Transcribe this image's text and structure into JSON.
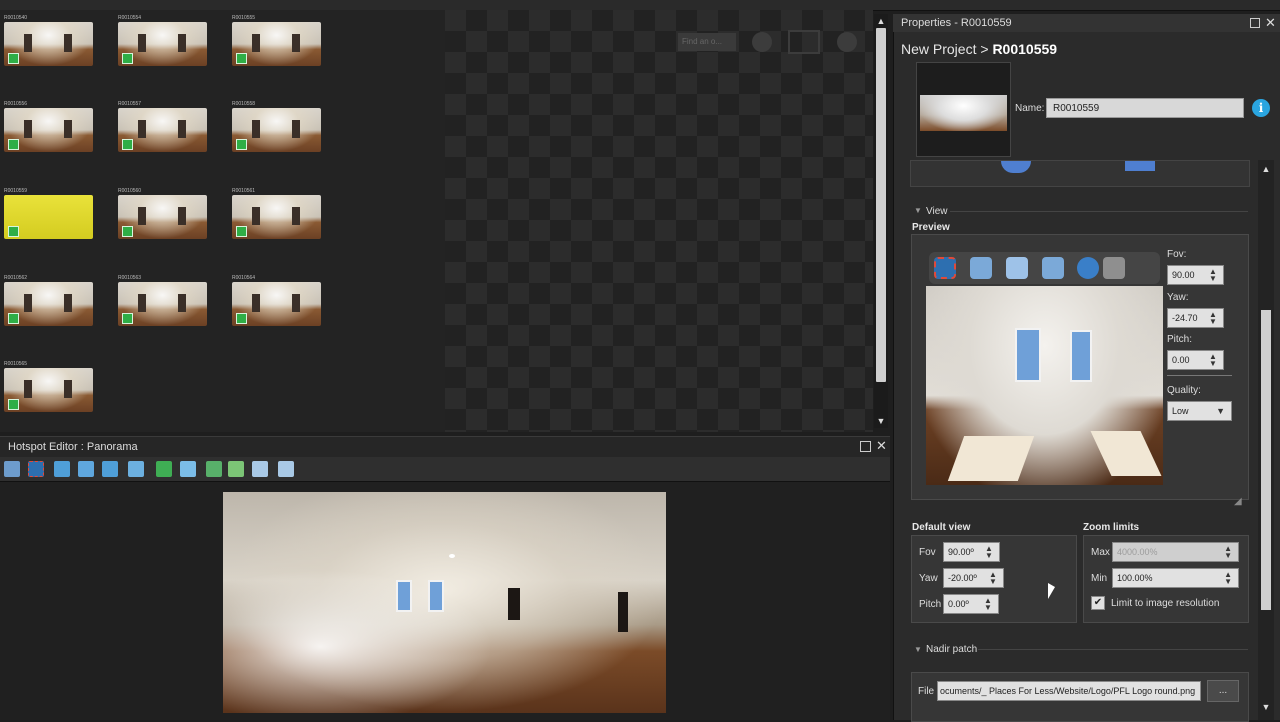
{
  "thumbnails": [
    {
      "label": "R0010540"
    },
    {
      "label": "R0010554"
    },
    {
      "label": "R0010555"
    },
    {
      "label": "R0010556"
    },
    {
      "label": "R0010557"
    },
    {
      "label": "R0010558"
    },
    {
      "label": "R0010559",
      "selected": true
    },
    {
      "label": "R0010560"
    },
    {
      "label": "R0010561"
    },
    {
      "label": "R0010562"
    },
    {
      "label": "R0010563"
    },
    {
      "label": "R0010564"
    },
    {
      "label": "R0010565"
    }
  ],
  "viewer": {
    "find_placeholder": "Find an o..."
  },
  "hotspot_editor": {
    "title": "Hotspot Editor : Panorama",
    "toolbar_icons": [
      "move-icon",
      "select-icon",
      "add-point-icon",
      "add-image-icon",
      "add-media-icon",
      "add-info-icon",
      "polygon-icon",
      "add-node-icon",
      "add-vertex-icon",
      "rectangle-icon",
      "image-icon",
      "image-edit-icon"
    ]
  },
  "properties": {
    "panel_title": "Properties - R0010559",
    "breadcrumb_prefix": "New Project >",
    "breadcrumb_current": "R0010559",
    "name_label": "Name:",
    "name_value": "R0010559",
    "view_section": "View",
    "preview_label": "Preview",
    "preview_tools": [
      "select-tool-icon",
      "zoom-icon",
      "fit-icon",
      "zoom-in-icon",
      "compass-icon",
      "hand-icon"
    ],
    "fov_label": "Fov:",
    "fov_value": "90.00",
    "yaw_label": "Yaw:",
    "yaw_value": "-24.70",
    "pitch_label": "Pitch:",
    "pitch_value": "0.00",
    "quality_label": "Quality:",
    "quality_value": "Low",
    "default_view": {
      "title": "Default view",
      "fov_label": "Fov",
      "fov_value": "90.00º",
      "yaw_label": "Yaw",
      "yaw_value": "-20.00º",
      "pitch_label": "Pitch",
      "pitch_value": "0.00º"
    },
    "zoom_limits": {
      "title": "Zoom limits",
      "max_label": "Max",
      "max_value": "4000.00%",
      "min_label": "Min",
      "min_value": "100.00%",
      "limit_label": "Limit to image resolution",
      "limit_checked": true
    },
    "nadir": {
      "title": "Nadir patch",
      "file_label": "File",
      "file_value": "ocuments/_ Places For Less/Website/Logo/PFL Logo round.png",
      "browse_label": "..."
    }
  }
}
